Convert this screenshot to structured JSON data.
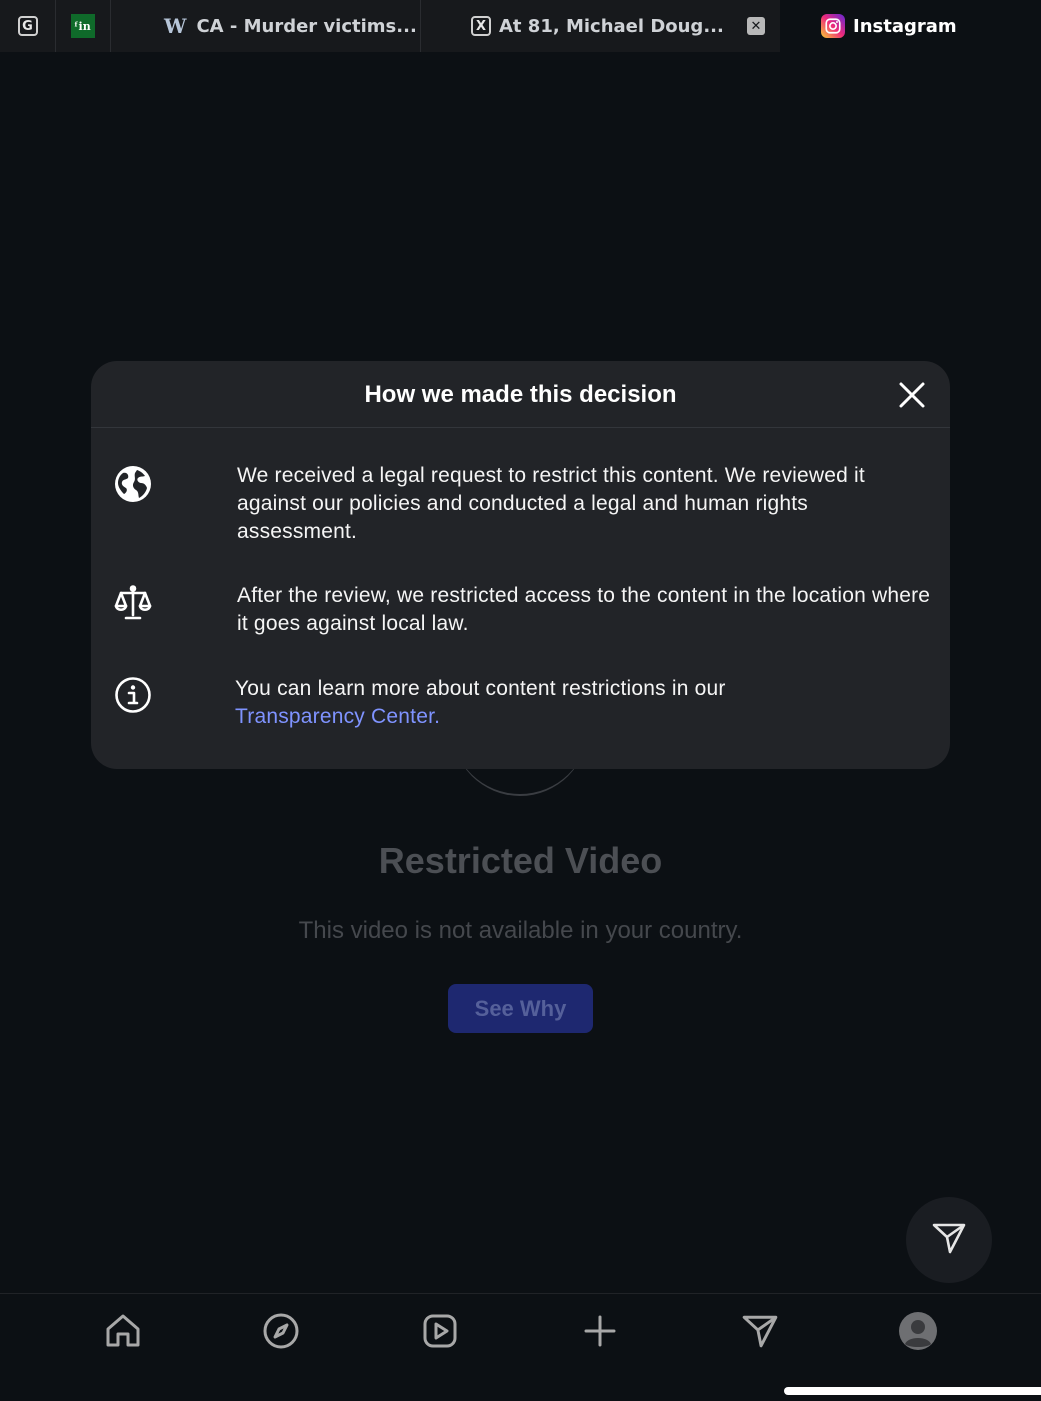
{
  "tabs": [
    {
      "title": "",
      "favicon": "g-letter-icon",
      "favicon_text": "G"
    },
    {
      "title": "",
      "favicon": "green-site-icon",
      "favicon_text": "ᶠin"
    },
    {
      "title": "CA - Murder victims...",
      "favicon": "w-icon",
      "favicon_text": "W"
    },
    {
      "title": "At 81, Michael Doug...",
      "favicon": "x-icon",
      "favicon_text": "X"
    },
    {
      "title": "",
      "favicon": "close-box-icon",
      "favicon_text": "✕"
    },
    {
      "title": "Instagram",
      "favicon": "instagram-icon",
      "active": true
    }
  ],
  "modal": {
    "title": "How we made this decision",
    "rows": [
      {
        "icon": "globe-icon",
        "text": "We received a legal request to restrict this content. We reviewed it against our policies and conducted a legal and human rights assessment."
      },
      {
        "icon": "scales-icon",
        "text": "After the review, we restricted access to the content in the location where it goes against local law."
      },
      {
        "icon": "info-icon",
        "text": "You can learn more about content restrictions in our",
        "link": "Transparency Center."
      }
    ]
  },
  "restricted": {
    "title": "Restricted Video",
    "subtitle": "This video is not available in your country.",
    "button": "See Why"
  },
  "nav": [
    "home-icon",
    "explore-icon",
    "reels-icon",
    "create-icon",
    "direct-icon",
    "profile-icon"
  ],
  "colors": {
    "background": "#0c1014",
    "modal": "#222428",
    "link": "#7f93ff",
    "button": "#1e2870"
  }
}
